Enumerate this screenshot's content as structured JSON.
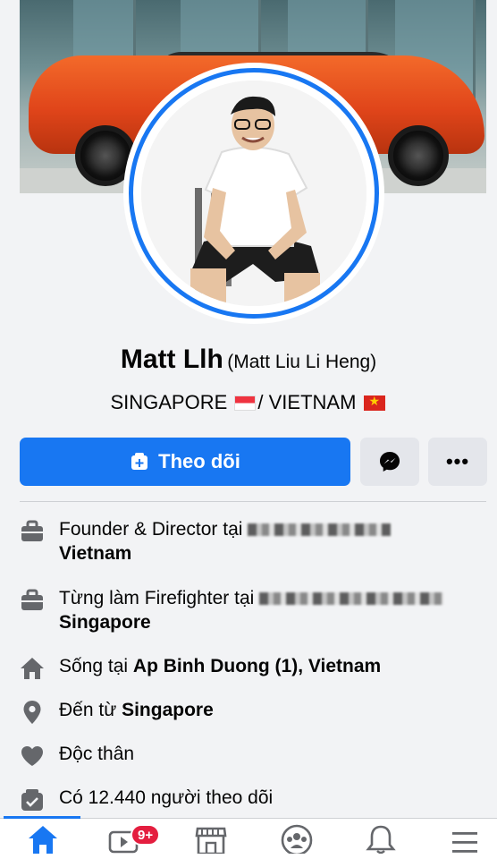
{
  "profile": {
    "name": "Matt Llh",
    "alternate_name": "(Matt Liu Li Heng)",
    "location_a": "SINGAPORE",
    "location_sep": "/ VIETNAM"
  },
  "actions": {
    "follow_label": "Theo dõi",
    "more_label": "•••"
  },
  "info": [
    {
      "icon": "briefcase-icon",
      "prefix": "Founder & Director tại",
      "bold": "Vietnam"
    },
    {
      "icon": "briefcase-icon",
      "prefix": "Từng làm Firefighter tại",
      "bold": "Singapore"
    },
    {
      "icon": "home-icon",
      "prefix": "Sống tại ",
      "bold": "Ap Binh Duong (1), Vietnam"
    },
    {
      "icon": "location-pin-icon",
      "prefix": "Đến từ ",
      "bold": "Singapore"
    },
    {
      "icon": "heart-icon",
      "prefix": "Độc thân",
      "bold": ""
    },
    {
      "icon": "followers-icon",
      "prefix": "Có 12.440 người theo dõi",
      "bold": ""
    }
  ],
  "nav": {
    "video_badge": "9+"
  },
  "colors": {
    "accent": "#1877f2",
    "badge": "#e41e3f",
    "button_secondary": "#e4e6eb"
  }
}
